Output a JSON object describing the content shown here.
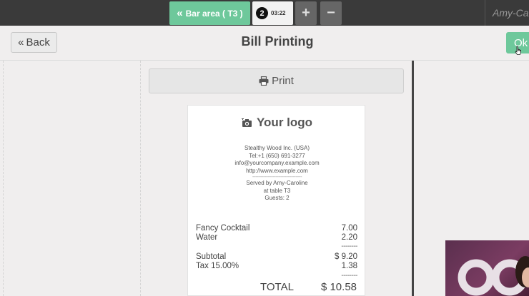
{
  "topbar": {
    "area_button": "Bar area ( T3 )",
    "order_number": "2",
    "order_time": "03:22",
    "add_label": "+",
    "remove_label": "−",
    "user_name": "Amy-Caroline"
  },
  "header": {
    "back_label": "Back",
    "title": "Bill Printing",
    "ok_label": "Ok"
  },
  "print_button": "Print",
  "receipt": {
    "logo_text": "Your logo",
    "company": "Stealthy Wood Inc. (USA)",
    "tel": "Tel:+1 (650) 691-3277",
    "email": "info@yourcompany.example.com",
    "website": "http://www.example.com",
    "separator": "--------------------------------",
    "served_by": "Served by Amy-Caroline",
    "table": "at table T3",
    "guests": "Guests: 2",
    "items": [
      {
        "name": "Fancy Cocktail",
        "price": "7.00"
      },
      {
        "name": "Water",
        "price": "2.20"
      }
    ],
    "dashes": "--------",
    "subtotal_label": "Subtotal",
    "subtotal_value": "$ 9.20",
    "tax_label": "Tax 15.00%",
    "tax_value": "1.38",
    "total_label": "TOTAL",
    "total_value": "$ 10.58"
  },
  "colors": {
    "accent_green": "#6ec89b",
    "topbar_bg": "#3a3a3a"
  }
}
